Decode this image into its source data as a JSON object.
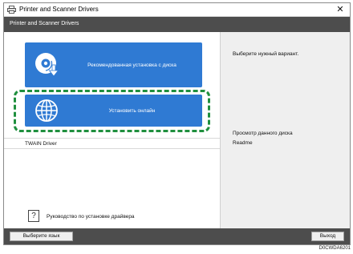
{
  "window": {
    "title": "Printer and Scanner Drivers",
    "close_glyph": "✕",
    "header": "Printer and Scanner Drivers"
  },
  "left_pane": {
    "recommended_install_label": "Рекомендованная установка с диска",
    "recommended_install_icon": "disc-download-icon",
    "online_install_label": "Установить онлайн",
    "online_install_icon": "globe-icon",
    "twain_label": "TWAIN Driver",
    "help_icon_glyph": "?",
    "help_text": "Руководство по установке драйвера"
  },
  "right_pane": {
    "instruction": "Выберите нужный вариант.",
    "browse_disc": "Просмотр данного диска",
    "readme": "Readme"
  },
  "bottom_bar": {
    "language_button": "Выберите язык",
    "exit_button": "Выход"
  },
  "figure_code": "D0CWDA6201",
  "colors": {
    "accent_button": "#2f7ad3",
    "highlight_dash": "#1f8f3e",
    "header_band": "#4d4d4d"
  }
}
